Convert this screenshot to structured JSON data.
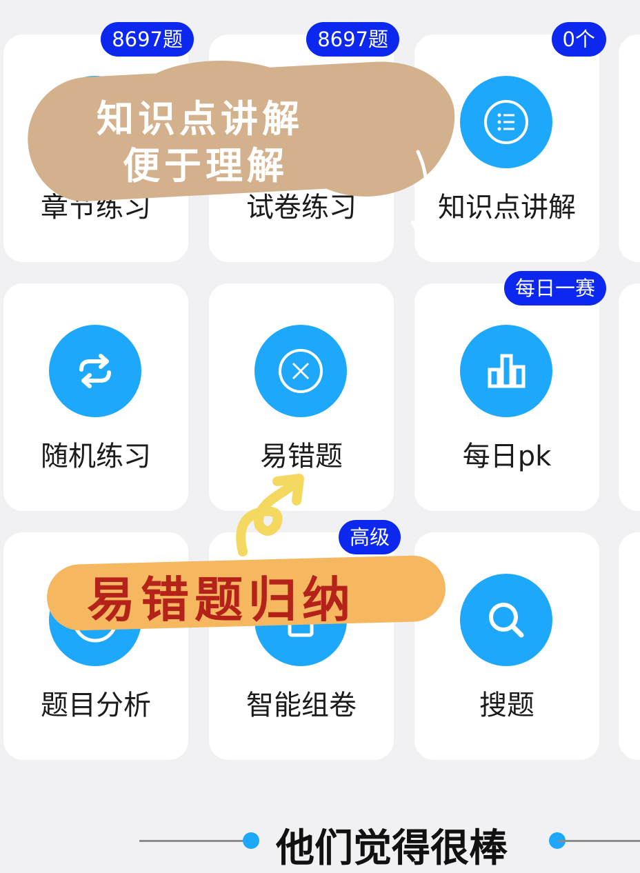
{
  "grid": [
    {
      "label": "章节练习",
      "badge": "8697题",
      "icon": "book-icon"
    },
    {
      "label": "试卷练习",
      "badge": "8697题",
      "icon": "paper-icon"
    },
    {
      "label": "知识点讲解",
      "badge": "0个",
      "icon": "list-icon"
    },
    {
      "label": "随机练习",
      "badge": "",
      "icon": "shuffle-icon"
    },
    {
      "label": "易错题",
      "badge": "",
      "icon": "error-x-icon"
    },
    {
      "label": "每日pk",
      "badge": "每日一赛",
      "icon": "bar-chart-icon"
    },
    {
      "label": "题目分析",
      "badge": "",
      "icon": "analysis-icon"
    },
    {
      "label": "智能组卷",
      "badge": "高级",
      "icon": "compose-icon"
    },
    {
      "label": "搜题",
      "badge": "",
      "icon": "search-icon"
    }
  ],
  "overlays": {
    "note1_line1": "知识点讲解",
    "note1_line2": "便于理解",
    "note2": "易错题归纳"
  },
  "footer": {
    "title": "他们觉得很棒"
  },
  "colors": {
    "accent": "#1ea8fb",
    "badge": "#0c27ee",
    "note1_bg": "#d3b18d",
    "note2_bg": "#f5b760",
    "note2_text": "#b42219"
  }
}
